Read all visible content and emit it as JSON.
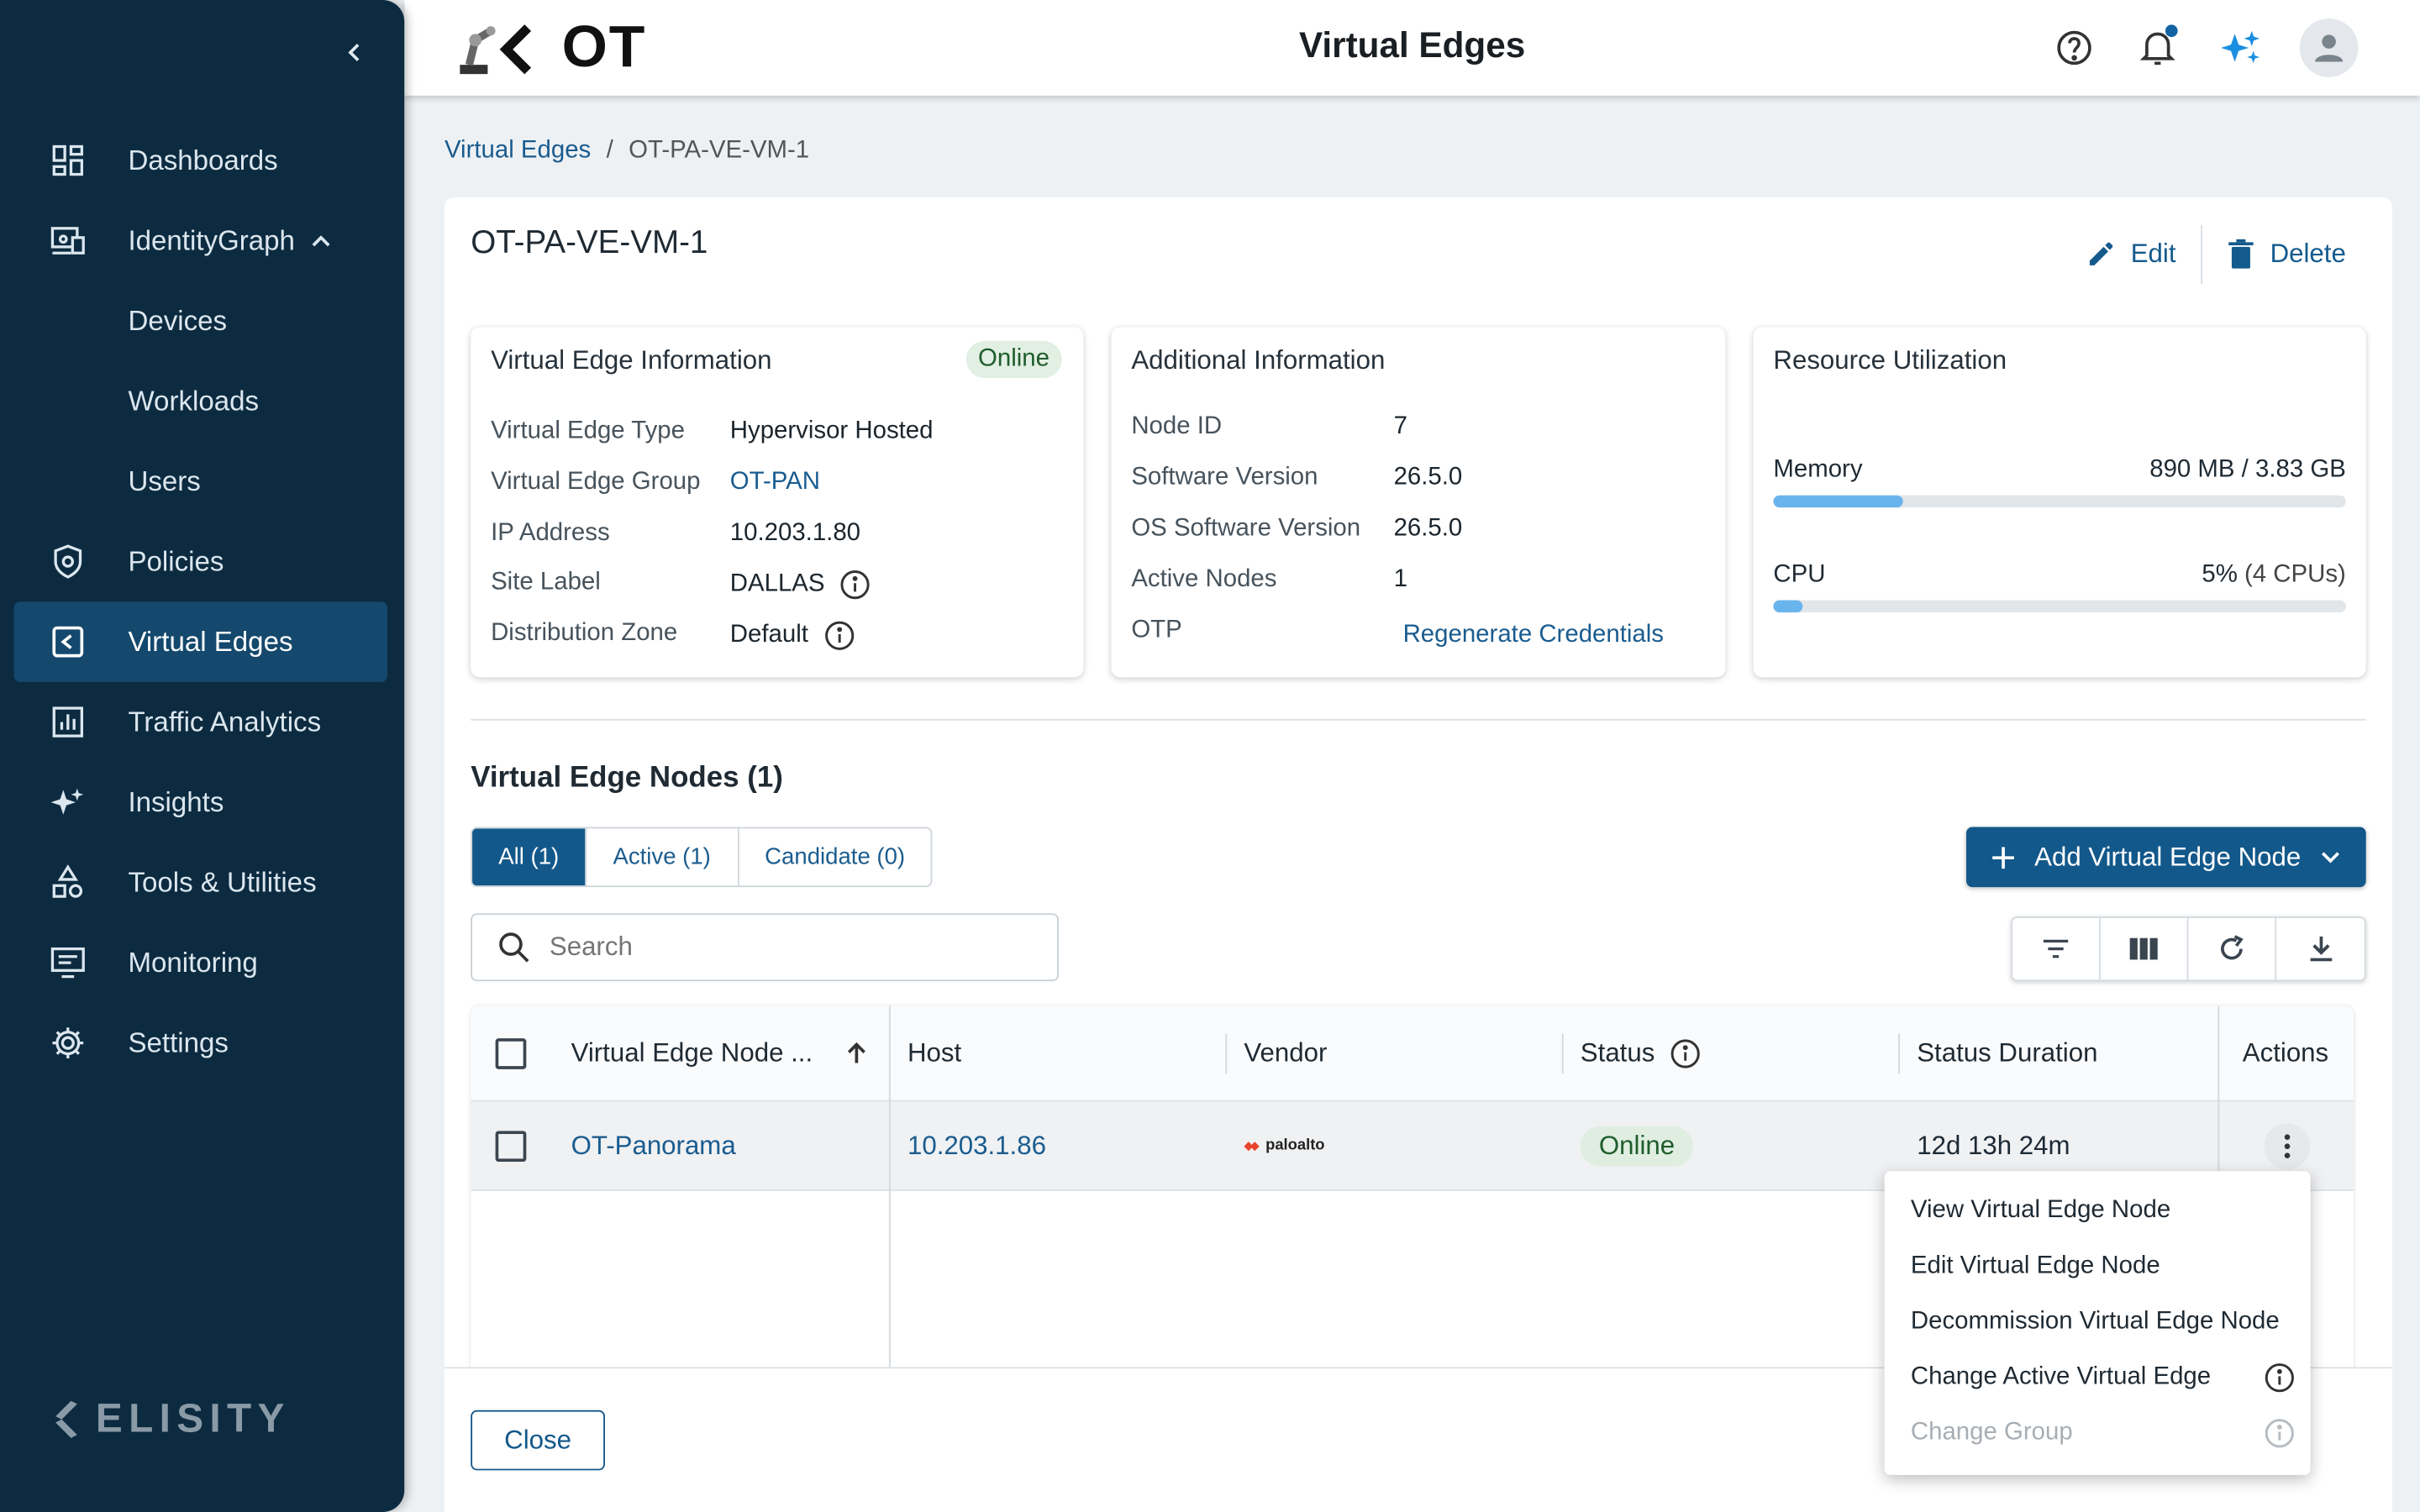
{
  "sidebar": {
    "items": [
      {
        "label": "Dashboards",
        "icon": "dashboard-icon"
      },
      {
        "label": "IdentityGraph",
        "icon": "identity-graph-icon"
      },
      {
        "label": "Devices"
      },
      {
        "label": "Workloads"
      },
      {
        "label": "Users"
      },
      {
        "label": "Policies",
        "icon": "shield-icon"
      },
      {
        "label": "Virtual Edges",
        "icon": "virtual-edge-icon"
      },
      {
        "label": "Traffic Analytics",
        "icon": "chart-icon"
      },
      {
        "label": "Insights",
        "icon": "sparkle-icon"
      },
      {
        "label": "Tools & Utilities",
        "icon": "tools-icon"
      },
      {
        "label": "Monitoring",
        "icon": "monitor-icon"
      },
      {
        "label": "Settings",
        "icon": "gear-icon"
      }
    ],
    "brand": "ELISITY"
  },
  "header": {
    "logo_text": "OT",
    "title": "Virtual Edges"
  },
  "breadcrumb": {
    "parent": "Virtual Edges",
    "separator": "/",
    "current": "OT-PA-VE-VM-1"
  },
  "detail": {
    "title": "OT-PA-VE-VM-1",
    "edit_label": "Edit",
    "delete_label": "Delete"
  },
  "ve_info": {
    "title": "Virtual Edge Information",
    "status": "Online",
    "rows": [
      {
        "key": "Virtual Edge Type",
        "value": "Hypervisor Hosted"
      },
      {
        "key": "Virtual Edge Group",
        "value": "OT-PAN"
      },
      {
        "key": "IP Address",
        "value": "10.203.1.80"
      },
      {
        "key": "Site Label",
        "value": "DALLAS"
      },
      {
        "key": "Distribution Zone",
        "value": "Default"
      }
    ]
  },
  "add_info": {
    "title": "Additional Information",
    "rows": [
      {
        "key": "Node ID",
        "value": "7"
      },
      {
        "key": "Software Version",
        "value": "26.5.0"
      },
      {
        "key": "OS Software Version",
        "value": "26.5.0"
      },
      {
        "key": "Active Nodes",
        "value": "1"
      },
      {
        "key": "OTP",
        "value": "Regenerate Credentials"
      }
    ]
  },
  "resources": {
    "title": "Resource Utilization",
    "memory_label": "Memory",
    "memory_value": "890 MB / 3.83 GB",
    "memory_fraction": 0.227,
    "cpu_label": "CPU",
    "cpu_value": "5%",
    "cpu_detail": "(4 CPUs)",
    "cpu_fraction": 0.05
  },
  "nodes": {
    "title": "Virtual Edge Nodes (1)",
    "tabs": [
      "All (1)",
      "Active (1)",
      "Candidate (0)"
    ],
    "add_label": "Add Virtual Edge Node",
    "search_placeholder": "Search",
    "columns": [
      "Virtual Edge Node ...",
      "Host",
      "Vendor",
      "Status",
      "Status Duration",
      "Actions"
    ],
    "rows": [
      {
        "name": "OT-Panorama",
        "host": "10.203.1.86",
        "vendor": "paloalto",
        "status": "Online",
        "duration": "12d 13h 24m"
      }
    ]
  },
  "menu": {
    "items": [
      {
        "label": "View Virtual Edge Node"
      },
      {
        "label": "Edit Virtual Edge Node"
      },
      {
        "label": "Decommission Virtual Edge Node"
      },
      {
        "label": "Change Active Virtual Edge"
      },
      {
        "label": "Change Group"
      }
    ]
  },
  "footer": {
    "close_label": "Close"
  },
  "colors": {
    "sidebar_bg": "#0c2b40",
    "primary": "#13588a",
    "online_bg": "#dfeee1",
    "bar_fill": "#6ab4ee"
  }
}
